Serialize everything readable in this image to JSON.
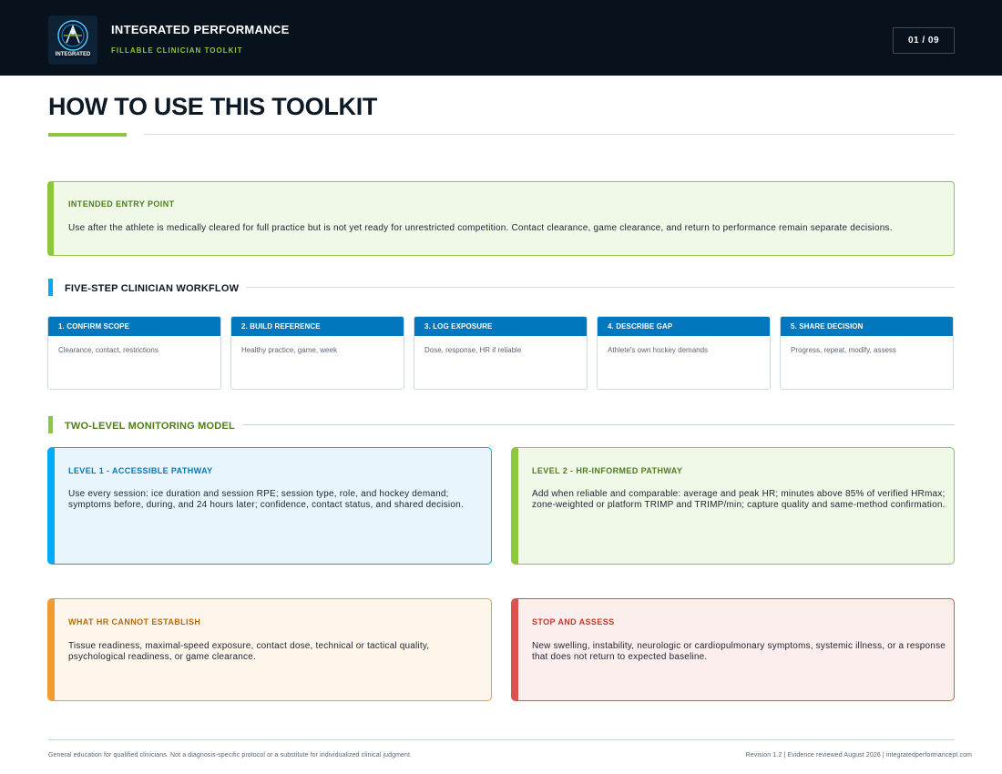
{
  "header": {
    "brand_title": "INTEGRATED PERFORMANCE",
    "brand_subtitle": "FILLABLE CLINICIAN TOOLKIT",
    "page_indicator": "01 / 09",
    "logo_text": "INTEGRATED"
  },
  "page": {
    "title": "HOW TO USE THIS TOOLKIT"
  },
  "entry_point": {
    "label": "INTENDED ENTRY POINT",
    "text": "Use after the athlete is medically cleared for full practice but is not yet ready for unrestricted competition. Contact clearance, game clearance, and return to performance remain separate decisions."
  },
  "workflow": {
    "title": "FIVE-STEP CLINICIAN WORKFLOW",
    "steps": [
      {
        "label": "1. CONFIRM SCOPE",
        "text": "Clearance, contact, restrictions"
      },
      {
        "label": "2. BUILD REFERENCE",
        "text": "Healthy practice, game, week"
      },
      {
        "label": "3. LOG EXPOSURE",
        "text": "Dose, response, HR if reliable"
      },
      {
        "label": "4. DESCRIBE GAP",
        "text": "Athlete's own hockey demands"
      },
      {
        "label": "5. SHARE DECISION",
        "text": "Progress, repeat, modify, assess"
      }
    ]
  },
  "monitoring": {
    "title": "TWO-LEVEL MONITORING MODEL",
    "level1": {
      "label": "LEVEL 1 - ACCESSIBLE PATHWAY",
      "line1": "Use every session: ice duration and session RPE; session type, role, and hockey demand;",
      "line2": "symptoms before, during, and 24 hours later; confidence, contact status, and shared decision."
    },
    "level2": {
      "label": "LEVEL 2 - HR-INFORMED PATHWAY",
      "line1": "Add when reliable and comparable: average and peak HR; minutes above 85% of verified HRmax;",
      "line2": "zone-weighted or platform TRIMP and TRIMP/min; capture quality and same-method confirmation."
    },
    "hr_limits": {
      "label": "WHAT HR CANNOT ESTABLISH",
      "line1": "Tissue readiness, maximal-speed exposure, contact dose, technical or tactical quality,",
      "line2": "psychological readiness, or game clearance."
    },
    "stop": {
      "label": "STOP AND ASSESS",
      "line1": "New swelling, instability, neurologic or cardiopulmonary symptoms, systemic illness, or a response",
      "line2": "that does not return to expected baseline."
    }
  },
  "footer": {
    "left": "General education for qualified clinicians. Not a diagnosis-specific protocol or a substitute for individualized clinical judgment.",
    "right": "Revision 1.2 | Evidence reviewed August 2026 | integratedperformancept.com"
  },
  "colors": {
    "header_bg": "#07121c",
    "accent_green": "#8dc63f",
    "accent_blue": "#0277bd",
    "level1_blue": "#03a9f4",
    "orange": "#f29b30",
    "red": "#d9534f"
  }
}
